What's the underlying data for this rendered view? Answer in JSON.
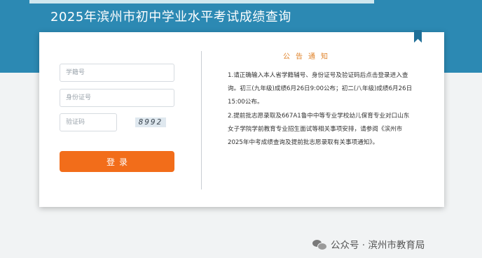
{
  "header": {
    "title": "2025年滨州市初中学业水平考试成绩查询",
    "background_color": "#2c89b3"
  },
  "login_form": {
    "student_id_placeholder": "学籍号",
    "id_card_placeholder": "身份证号",
    "captcha_placeholder": "验证码",
    "captcha_text": "8992",
    "login_button_label": "登录",
    "button_color": "#f26d1a"
  },
  "notice": {
    "title": "公告通知",
    "title_color": "#e0832a",
    "paragraphs": [
      "1.请正确输入本人省学籍辅号、身份证号及验证码后点击登录进入查询。初三(九年级)成绩6月26日9:00公布；初二(八年级)成绩6月26日15:00公布。",
      "2.提前批志愿录取及667A1鲁中中等专业学校幼儿保育专业对口山东女子学院学前教育专业招生面试等相关事项安排，请参阅《滨州市2025年中考成绩查询及提前批志愿录取有关事项通知》。"
    ]
  },
  "watermark": {
    "text": "公众号 · 滨州市教育局",
    "icon": "wechat-icon"
  }
}
